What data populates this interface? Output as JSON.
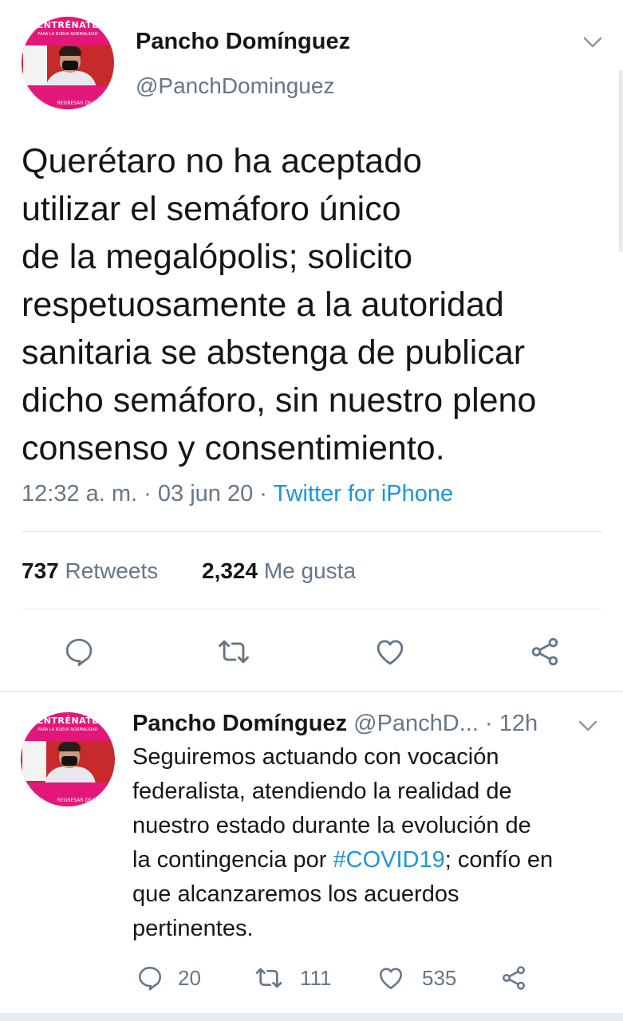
{
  "main_tweet": {
    "author_name": "Pancho Domínguez",
    "handle": "@PanchDominguez",
    "avatar": {
      "banner_top": "ENTRÉNATE",
      "banner_sub": "PARA LA NUEVA NORMALIDAD",
      "banner_bottom": "REGRESAR DE TODOS"
    },
    "text": "Querétaro no ha aceptado\nutilizar el semáforo único\nde la megalópolis; solicito\nrespetuosamente a la autoridad\nsanitaria se abstenga de publicar\ndicho semáforo, sin nuestro pleno\nconsenso y consentimiento.",
    "time": "12:32 a. m.",
    "separator": "·",
    "date": "03 jun 20",
    "source": "Twitter for iPhone",
    "retweets_count": "737",
    "retweets_label": "Retweets",
    "likes_count": "2,324",
    "likes_label": "Me gusta"
  },
  "reply_tweet": {
    "author_name": "Pancho Domínguez",
    "handle": "@PanchD...",
    "age": "· 12h",
    "avatar": {
      "banner_top": "ENTRÉNATE",
      "banner_sub": "PARA LA NUEVA NORMALIDAD",
      "banner_bottom": "REGRESAR DE TODOS"
    },
    "text_before": "Seguiremos actuando con vocación\nfederalista, atendiendo la realidad de\nnuestro estado durante la evolución de\nla contingencia por ",
    "hashtag": "#COVID19",
    "text_after": "; confío en\nque alcanzaremos los acuerdos\npertinentes.",
    "reply_count": "20",
    "retweet_count": "111",
    "like_count": "535"
  },
  "colors": {
    "link_blue": "#1b95e0",
    "secondary_gray": "#657786",
    "divider": "#e1e8ed",
    "avatar_pink": "#e3177a"
  }
}
